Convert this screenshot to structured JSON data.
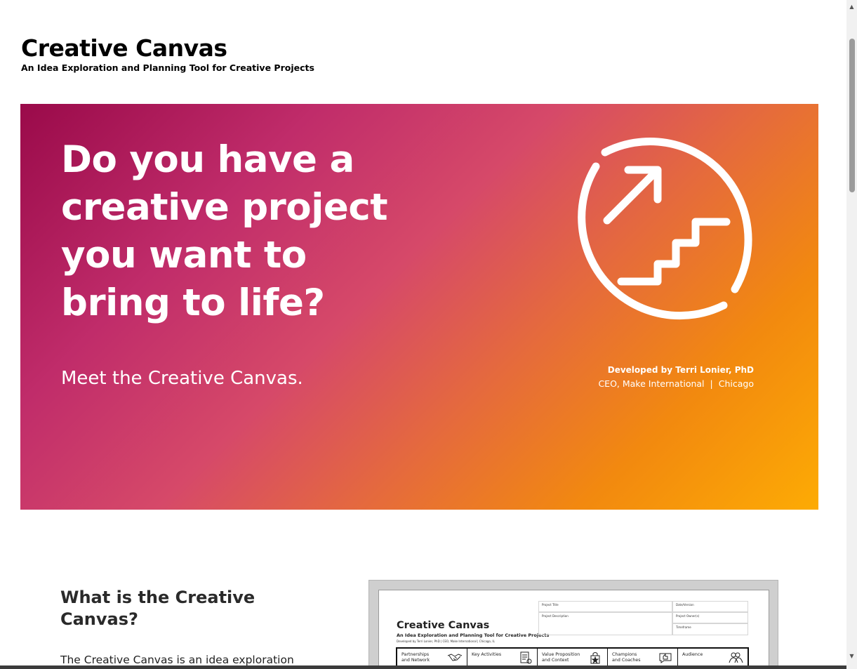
{
  "header": {
    "title": "Creative Canvas",
    "tagline": "An Idea Exploration and Planning Tool for Creative Projects"
  },
  "hero": {
    "headline": "Do you have a creative project you want to bring to life?",
    "subheadline": "Meet the Creative Canvas.",
    "icon": "growth-stairs-arrow-icon",
    "credit": {
      "name": "Developed by Terri Lonier, PhD",
      "role": "CEO, Make International",
      "separator": "|",
      "location": "Chicago"
    },
    "colors": {
      "gradient_start": "#9a0a4a",
      "gradient_mid": "#d64969",
      "gradient_end": "#fdab04"
    }
  },
  "section": {
    "heading": "What is the Creative Canvas?",
    "body_start": "The Creative Canvas is an idea exploration"
  },
  "preview": {
    "title": "Creative Canvas",
    "tagline": "An Idea Exploration and Planning Tool for Creative Projects",
    "developer": "Developed by Terri Lonier, PhD  |  CEO, Make International  |  Chicago, IL",
    "fields": {
      "project_title": "Project Title",
      "date_version": "Date/Version",
      "project_description": "Project Description",
      "project_owners": "Project Owner(s)",
      "timeframe": "Timeframe"
    },
    "columns": [
      {
        "label": "Partnerships\nand Network",
        "icon": "handshake-icon"
      },
      {
        "label": "Key Activities",
        "icon": "checklist-icon"
      },
      {
        "label": "Value Proposition\nand Context",
        "icon": "star-bag-icon"
      },
      {
        "label": "Champions\nand Coaches",
        "icon": "thumbs-up-speech-icon"
      },
      {
        "label": "Audience",
        "icon": "people-group-icon"
      }
    ]
  }
}
